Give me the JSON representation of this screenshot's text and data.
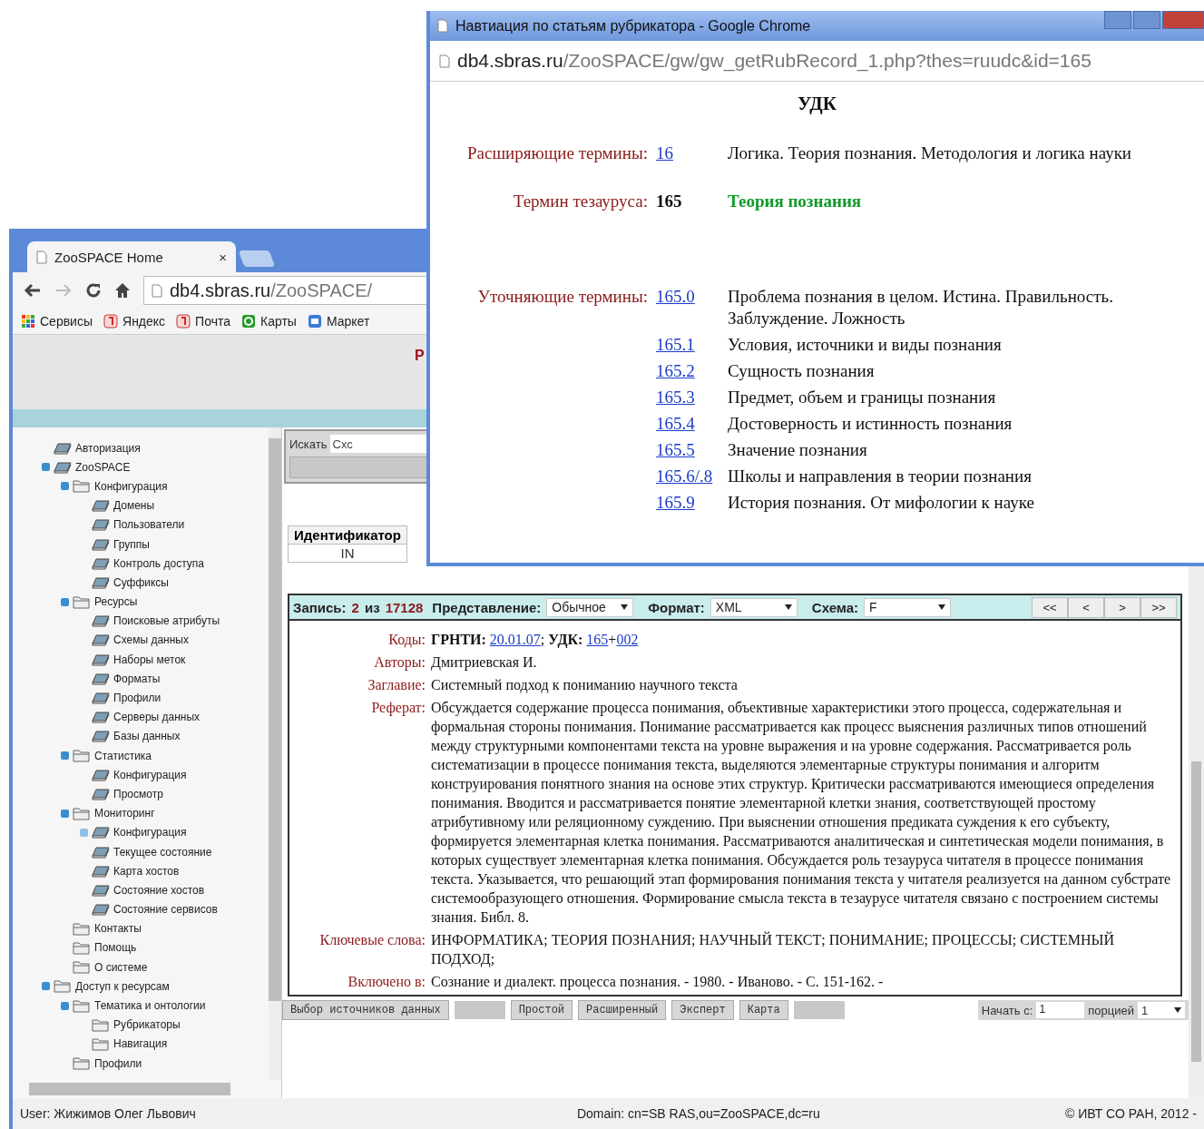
{
  "back_window": {
    "tab": {
      "title": "ZooSPACE Home",
      "close": "×"
    },
    "address": {
      "domain": "db4.sbras.ru",
      "path": "/ZooSPACE/"
    },
    "bookmarks": [
      {
        "label": "Сервисы",
        "kind": "apps"
      },
      {
        "label": "Яндекс",
        "kind": "yandex"
      },
      {
        "label": "Почта",
        "kind": "yandex"
      },
      {
        "label": "Карты",
        "kind": "maps"
      },
      {
        "label": "Маркет",
        "kind": "market"
      }
    ],
    "header_fragment": "Р"
  },
  "tree": [
    {
      "label": "Авторизация",
      "kind": "item"
    },
    {
      "label": "ZooSPACE",
      "kind": "item",
      "expanded": true,
      "children": [
        {
          "label": "Конфигурация",
          "kind": "folder",
          "expanded": true,
          "children": [
            {
              "label": "Домены",
              "kind": "item"
            },
            {
              "label": "Пользователи",
              "kind": "item"
            },
            {
              "label": "Группы",
              "kind": "item"
            },
            {
              "label": "Контроль доступа",
              "kind": "item"
            },
            {
              "label": "Суффиксы",
              "kind": "item"
            }
          ]
        },
        {
          "label": "Ресурсы",
          "kind": "folder",
          "expanded": true,
          "children": [
            {
              "label": "Поисковые атрибуты",
              "kind": "item"
            },
            {
              "label": "Схемы данных",
              "kind": "item"
            },
            {
              "label": "Наборы меток",
              "kind": "item"
            },
            {
              "label": "Форматы",
              "kind": "item"
            },
            {
              "label": "Профили",
              "kind": "item"
            },
            {
              "label": "Серверы данных",
              "kind": "item"
            },
            {
              "label": "Базы данных",
              "kind": "item"
            }
          ]
        },
        {
          "label": "Статистика",
          "kind": "folder",
          "expanded": true,
          "children": [
            {
              "label": "Конфигурация",
              "kind": "item"
            },
            {
              "label": "Просмотр",
              "kind": "item"
            }
          ]
        },
        {
          "label": "Мониторинг",
          "kind": "folder",
          "expanded": true,
          "children": [
            {
              "label": "Конфигурация",
              "kind": "item",
              "expanded": false
            },
            {
              "label": "Текущее состояние",
              "kind": "item"
            },
            {
              "label": "Карта хостов",
              "kind": "item"
            },
            {
              "label": "Состояние хостов",
              "kind": "item"
            },
            {
              "label": "Состояние сервисов",
              "kind": "item"
            }
          ]
        },
        {
          "label": "Контакты",
          "kind": "folder"
        },
        {
          "label": "Помощь",
          "kind": "folder"
        },
        {
          "label": "О системе",
          "kind": "folder"
        }
      ]
    },
    {
      "label": "Доступ к ресурсам",
      "kind": "folder",
      "expanded": true,
      "children": [
        {
          "label": "Тематика и онтологии",
          "kind": "folder",
          "expanded": true,
          "children": [
            {
              "label": "Рубрикаторы",
              "kind": "folder"
            },
            {
              "label": "Навигация",
              "kind": "folder"
            }
          ]
        },
        {
          "label": "Профили",
          "kind": "folder"
        }
      ]
    }
  ],
  "search": {
    "label": "Искать",
    "value": "Схс"
  },
  "table": {
    "columns": [
      "Идентификатор"
    ],
    "rows": [
      [
        "IN"
      ]
    ]
  },
  "record_toolbar": {
    "record_label": "Запись:",
    "record_number": "2",
    "of_label": "из",
    "total": "17128",
    "selects": [
      {
        "label": "Представление:",
        "value": "Обычное"
      },
      {
        "label": "Формат:",
        "value": "XML"
      },
      {
        "label": "Схема:",
        "value": "F"
      }
    ],
    "nav": [
      "<<",
      "<",
      ">",
      ">>"
    ]
  },
  "record": {
    "fields": [
      {
        "label": "Коды:",
        "parts": [
          {
            "kind": "bold",
            "text": "ГРНТИ:"
          },
          {
            "kind": "link",
            "text": "20.01.07"
          },
          {
            "kind": "text",
            "text": ";"
          },
          {
            "kind": "bold",
            "text": "УДК:"
          },
          {
            "kind": "link",
            "text": "165"
          },
          {
            "kind": "text",
            "text": "+"
          },
          {
            "kind": "link",
            "text": "002"
          }
        ]
      },
      {
        "label": "Авторы:",
        "parts": [
          {
            "kind": "text",
            "text": "Дмитриевская И."
          }
        ]
      },
      {
        "label": "Заглавие:",
        "parts": [
          {
            "kind": "text",
            "text": "Системный подход к пониманию научного текста"
          }
        ]
      },
      {
        "label": "Реферат:",
        "parts": [
          {
            "kind": "text",
            "text": "Обсуждается содержание процесса понимания, объективные характеристики этого процесса, содержательная и формальная стороны понимания. Понимание рассматривается как процесс выяснения различных типов отношений между структурными компонентами текста на уровне выражения и на уровне содержания. Рассматривается роль систематизации в процессе понимания текста, выделяются элементарные структуры понимания и алгоритм конструирования понятного знания на основе этих структур. Критически рассматриваются имеющиеся определения понимания. Вводится и рассматривается понятие элементарной клетки знания, соответствующей простому атрибутивному или реляционному суждению. При выяснении отношения предиката суждения к его субъекту, формируется элементарная клетка понимания. Рассматриваются аналитическая и синтетическая модели понимания, в которых существует элементарная клетка понимания. Обсуждается роль тезауруса читателя в процессе понимания текста. Указывается, что решающий этап формирования понимания текста у читателя реализуется на данном субстрате системообразующего отношения. Формирование смысла текста в тезаурусе читателя связано с построением системы знания. Библ. 8."
          }
        ]
      },
      {
        "label": "Ключевые слова:",
        "parts": [
          {
            "kind": "text",
            "text": "ИНФОРМАТИКА; ТЕОРИЯ ПОЗНАНИЯ; НАУЧНЫЙ ТЕКСТ; ПОНИМАНИЕ; ПРОЦЕССЫ; СИСТЕМНЫЙ ПОДХОД;"
          }
        ]
      },
      {
        "label": "Включено в:",
        "parts": [
          {
            "kind": "text",
            "text": "Сознание и диалект. процесса познания. - 1980. - Иваново. - С. 151-162. -"
          }
        ]
      }
    ]
  },
  "bottom_bar": {
    "sources_button": "Выбор источников данных",
    "modes": [
      "Простой",
      "Расширенный",
      "Эксперт",
      "Карта"
    ],
    "start_label": "Начать с:",
    "start_value": "1",
    "portion_label": "порцией",
    "portion_value": "1"
  },
  "status_bar": {
    "user": "User: Жижимов Олег Львович",
    "domain": "Domain: cn=SB RAS,ou=ZooSPACE,dc=ru",
    "copyright": "© ИВТ СО РАН, 2012 -"
  },
  "popup": {
    "title": "Навтиация по статьям рубрикатора - Google Chrome",
    "address": {
      "domain": "db4.sbras.ru",
      "path": "/ZooSPACE/gw/gw_getRubRecord_1.php?thes=ruudc&id=165"
    },
    "heading": "УДК",
    "broader": {
      "label": "Расширяющие термины:",
      "code": "16",
      "text": "Логика. Теория познания. Методология и логика науки"
    },
    "term": {
      "label": "Термин тезауруса:",
      "code": "165",
      "text": "Теория познания"
    },
    "narrower": {
      "label": "Уточняющие термины:",
      "items": [
        {
          "code": "165.0",
          "text": "Проблема познания в целом. Истина. Правильность. Заблуждение. Ложность"
        },
        {
          "code": "165.1",
          "text": "Условия, источники и виды познания"
        },
        {
          "code": "165.2",
          "text": "Сущность познания"
        },
        {
          "code": "165.3",
          "text": "Предмет, объем и границы познания"
        },
        {
          "code": "165.4",
          "text": "Достоверность и истинность познания"
        },
        {
          "code": "165.5",
          "text": "Значение познания"
        },
        {
          "code": "165.6/.8",
          "text": "Школы и направления в теории познания"
        },
        {
          "code": "165.9",
          "text": "История познания. От мифологии к науке"
        }
      ]
    }
  }
}
